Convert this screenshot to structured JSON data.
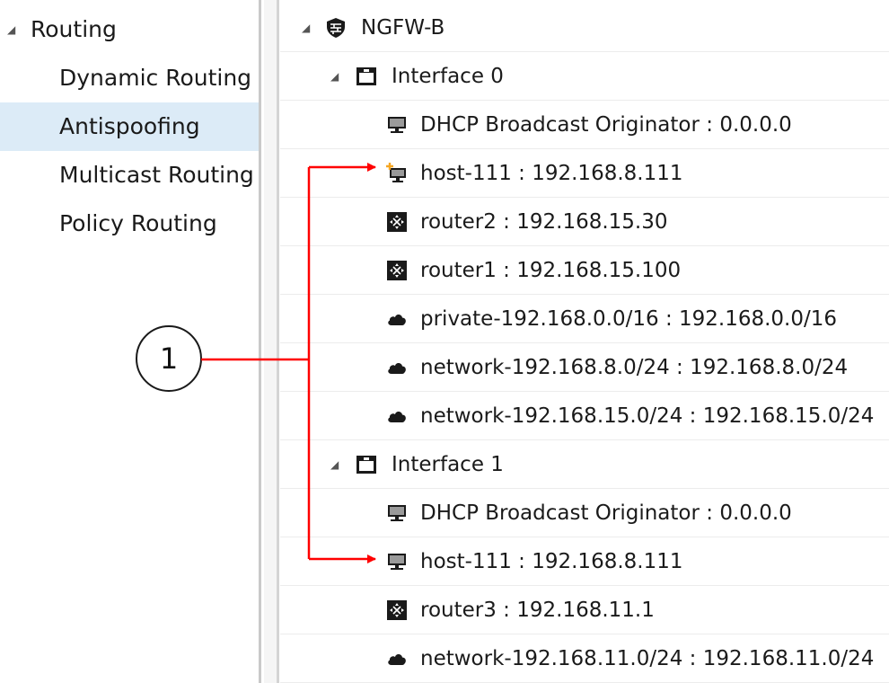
{
  "nav": {
    "items": [
      {
        "label": "Routing",
        "expanded": true
      },
      {
        "label": "Dynamic Routing"
      },
      {
        "label": "Antispoofing",
        "selected": true
      },
      {
        "label": "Multicast Routing"
      },
      {
        "label": "Policy Routing"
      }
    ]
  },
  "tree": {
    "rows": [
      {
        "text": "NGFW-B",
        "icon": "firewall-icon"
      },
      {
        "text": "Interface 0",
        "icon": "interface-icon"
      },
      {
        "text": "DHCP Broadcast Originator : 0.0.0.0",
        "icon": "host-icon"
      },
      {
        "text": "host-111 : 192.168.8.111",
        "icon": "host-added-icon"
      },
      {
        "text": "router2 : 192.168.15.30",
        "icon": "router-icon"
      },
      {
        "text": "router1 : 192.168.15.100",
        "icon": "router-icon"
      },
      {
        "text": "private-192.168.0.0/16 : 192.168.0.0/16",
        "icon": "network-icon"
      },
      {
        "text": "network-192.168.8.0/24 : 192.168.8.0/24",
        "icon": "network-icon"
      },
      {
        "text": "network-192.168.15.0/24 : 192.168.15.0/24",
        "icon": "network-icon"
      },
      {
        "text": "Interface 1",
        "icon": "interface-icon"
      },
      {
        "text": "DHCP Broadcast Originator : 0.0.0.0",
        "icon": "host-icon"
      },
      {
        "text": "host-111 : 192.168.8.111",
        "icon": "host-icon"
      },
      {
        "text": "router3 : 192.168.11.1",
        "icon": "router-icon"
      },
      {
        "text": "network-192.168.11.0/24 : 192.168.11.0/24",
        "icon": "network-icon"
      }
    ]
  },
  "callout": {
    "number": "1"
  },
  "colors": {
    "selected_bg": "#dcebf7",
    "callout_arrow": "#ff0000",
    "added_badge": "#f5a623"
  }
}
